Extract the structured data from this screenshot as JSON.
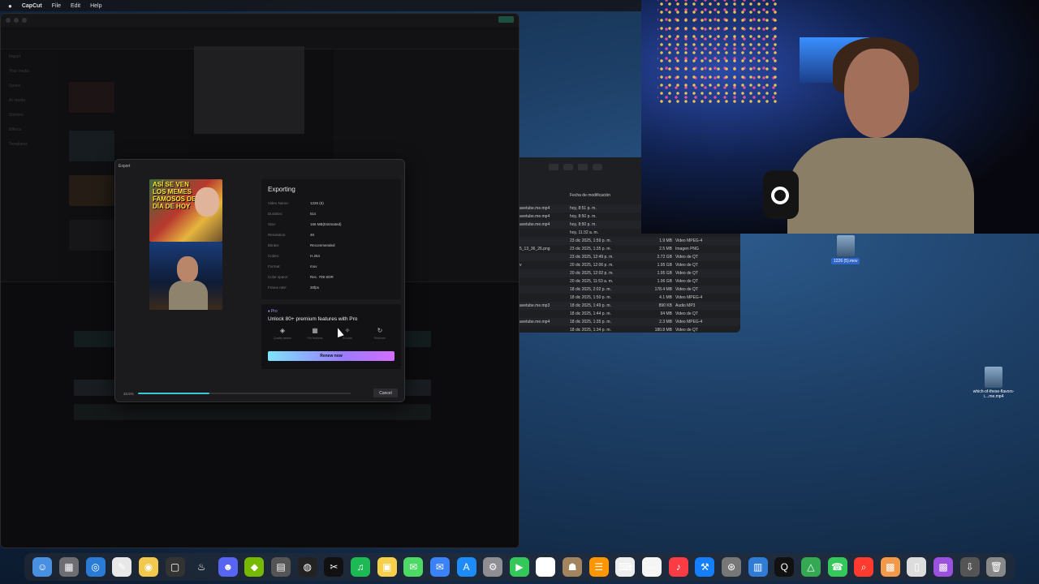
{
  "menubar": {
    "app": "CapCut",
    "items": [
      "File",
      "Edit",
      "Help"
    ]
  },
  "capcut": {
    "sidebar_items": [
      "Import",
      "Your media",
      "Space",
      "AI media",
      "Stickers",
      "Effects",
      "Templates"
    ]
  },
  "export_dialog": {
    "title": "Export",
    "heading": "Exporting",
    "thumb_text": "ASÍ SE VEN LOS MEMES FAMOSOS DEL DÍA DE HOY",
    "details": [
      {
        "key": "Video Name:",
        "value": "1226 (5)"
      },
      {
        "key": "Duration:",
        "value": "51s"
      },
      {
        "key": "Size:",
        "value": "166 MB(Estimated)"
      },
      {
        "key": "Resolution:",
        "value": "4K"
      },
      {
        "key": "Bitrate:",
        "value": "Recommended"
      },
      {
        "key": "Codec:",
        "value": "H.264"
      },
      {
        "key": "Format:",
        "value": "mov"
      },
      {
        "key": "Color space:",
        "value": "Rec. 709 SDR"
      },
      {
        "key": "Frame rate:",
        "value": "30fps"
      }
    ],
    "promo": {
      "badge": "Pro",
      "headline": "Unlock 80+ premium features with Pro",
      "features": [
        {
          "icon": "quality-icon",
          "glyph": "◈",
          "label": "Quality assets"
        },
        {
          "icon": "grid-icon",
          "glyph": "▦",
          "label": "Pro features"
        },
        {
          "icon": "magic-wand-icon",
          "glyph": "✧",
          "label": "AI tools"
        },
        {
          "icon": "refresh-icon",
          "glyph": "↻",
          "label": "Relaunch"
        }
      ],
      "button": "Renew now"
    },
    "progress_text": "33.5%",
    "progress": 0.335,
    "cancel": "Cancel"
  },
  "finder": {
    "column_header": "Fecha de modificación",
    "rows": [
      {
        "name": "avetube.me.mp4",
        "date": "hoy, 8:51 p. m.",
        "size": "",
        "kind": ""
      },
      {
        "name": "avetube.me.mp4",
        "date": "hoy, 8:50 p. m.",
        "size": "",
        "kind": ""
      },
      {
        "name": "avetube.me.mp4",
        "date": "hoy, 8:50 p. m.",
        "size": "",
        "kind": ""
      },
      {
        "name": "",
        "date": "hoy, 11:32 a. m.",
        "size": "",
        "kind": ""
      },
      {
        "name": "",
        "date": "23 dic 2025, 1:59 p. m.",
        "size": "1.9 MB",
        "kind": "Video MPEG-4"
      },
      {
        "name": "5_13_36_26.png",
        "date": "23 dic 2025, 1:35 p. m.",
        "size": "2.5 MB",
        "kind": "Imagen PNG"
      },
      {
        "name": "",
        "date": "23 dic 2025, 12:49 p. m.",
        "size": "2.72 GB",
        "kind": "Video de QT"
      },
      {
        "name": "v",
        "date": "20 dic 2025, 12:06 p. m.",
        "size": "1.95 GB",
        "kind": "Video de QT"
      },
      {
        "name": "",
        "date": "20 dic 2025, 12:02 p. m.",
        "size": "1.95 GB",
        "kind": "Video de QT"
      },
      {
        "name": "",
        "date": "20 dic 2025, 11:53 a. m.",
        "size": "1.96 GB",
        "kind": "Video de QT"
      },
      {
        "name": "",
        "date": "18 dic 2025, 2:02 p. m.",
        "size": "178.4 MB",
        "kind": "Video de QT"
      },
      {
        "name": "",
        "date": "18 dic 2025, 1:50 p. m.",
        "size": "4.1 MB",
        "kind": "Video MPEG-4"
      },
      {
        "name": "avetube.me.mp3",
        "date": "18 dic 2025, 1:49 p. m.",
        "size": "890 KB",
        "kind": "Audio MP3"
      },
      {
        "name": "",
        "date": "18 dic 2025, 1:44 p. m.",
        "size": "94 MB",
        "kind": "Video de QT"
      },
      {
        "name": "avetube.me.mp4",
        "date": "18 dic 2025, 1:35 p. m.",
        "size": "2.3 MB",
        "kind": "Video MPEG-4"
      },
      {
        "name": "",
        "date": "18 dic 2025, 1:34 p. m.",
        "size": "180.8 MB",
        "kind": "Video de QT"
      }
    ]
  },
  "desktop": {
    "file1_label": "1226 (5).mov",
    "file2_label": "which-of-these-flavors-i....me.mp4"
  },
  "dock": {
    "apps": [
      {
        "icon": "finder-icon",
        "glyph": "☺"
      },
      {
        "icon": "launchpad-icon",
        "glyph": "▦"
      },
      {
        "icon": "safari-icon",
        "glyph": "◎"
      },
      {
        "icon": "pencil-icon",
        "glyph": "✎"
      },
      {
        "icon": "chrome-icon",
        "glyph": "◉"
      },
      {
        "icon": "blank-app-icon",
        "glyph": "▢"
      },
      {
        "icon": "steam-icon",
        "glyph": "♨"
      },
      {
        "icon": "discord-icon",
        "glyph": "☻"
      },
      {
        "icon": "nvidia-icon",
        "glyph": "◆"
      },
      {
        "icon": "calculator-icon",
        "glyph": "▤"
      },
      {
        "icon": "obs-icon",
        "glyph": "◍"
      },
      {
        "icon": "capcut-icon",
        "glyph": "✂"
      },
      {
        "icon": "spotify-icon",
        "glyph": "♫"
      },
      {
        "icon": "notes-icon",
        "glyph": "▣"
      },
      {
        "icon": "messages-icon",
        "glyph": "✉"
      },
      {
        "icon": "mail-icon",
        "glyph": "✉"
      },
      {
        "icon": "appstore-icon",
        "glyph": "A"
      },
      {
        "icon": "settings-icon",
        "glyph": "⚙"
      },
      {
        "icon": "facetime-icon",
        "glyph": "▶"
      },
      {
        "icon": "calendar-icon",
        "glyph": "26"
      },
      {
        "icon": "contacts-icon",
        "glyph": "☗"
      },
      {
        "icon": "reminders-icon",
        "glyph": "☰"
      },
      {
        "icon": "keyboard-icon",
        "glyph": "⌨"
      },
      {
        "icon": "freeform-icon",
        "glyph": "〰"
      },
      {
        "icon": "music-icon",
        "glyph": "♪"
      },
      {
        "icon": "xcode-icon",
        "glyph": "⚒"
      },
      {
        "icon": "system-icon",
        "glyph": "⊛"
      },
      {
        "icon": "files-icon",
        "glyph": "▥"
      },
      {
        "icon": "quicktime-icon",
        "glyph": "Q"
      },
      {
        "icon": "drive-icon",
        "glyph": "△"
      },
      {
        "icon": "phone-icon",
        "glyph": "☎"
      },
      {
        "icon": "search-icon",
        "glyph": "⌕"
      },
      {
        "icon": "folder-images-icon",
        "glyph": "▩"
      },
      {
        "icon": "document-icon",
        "glyph": "▯"
      },
      {
        "icon": "image-stack-icon",
        "glyph": "▩"
      },
      {
        "icon": "download-icon",
        "glyph": "⇩"
      },
      {
        "icon": "trash-icon",
        "glyph": "🗑"
      }
    ]
  }
}
